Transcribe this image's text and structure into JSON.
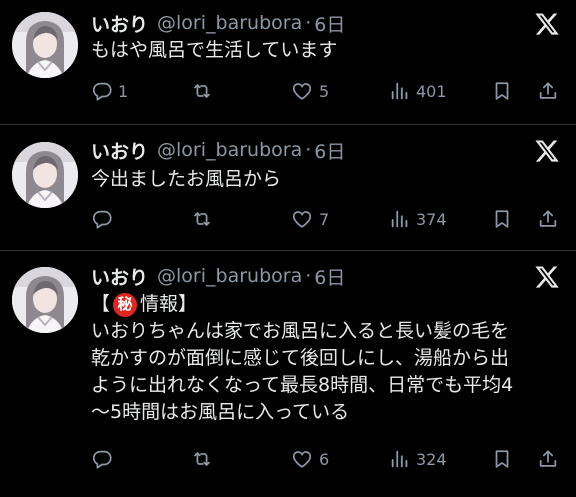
{
  "tweets": [
    {
      "display_name": "いおり",
      "handle": "@lori_barubora",
      "separator": "·",
      "time": "6日",
      "lines": [
        "もはや風呂で生活しています"
      ],
      "replies": "1",
      "retweets": "",
      "likes": "5",
      "views": "401"
    },
    {
      "display_name": "いおり",
      "handle": "@lori_barubora",
      "separator": "·",
      "time": "6日",
      "lines": [
        "今出ましたお風呂から"
      ],
      "replies": "",
      "retweets": "",
      "likes": "7",
      "views": "374"
    },
    {
      "display_name": "いおり",
      "handle": "@lori_barubora",
      "separator": "·",
      "time": "6日",
      "tag_open": "【",
      "tag_badge": "秘",
      "tag_label": "情報】",
      "lines": [
        "いおりちゃんは家でお風呂に入ると長い髪の毛を",
        "乾かすのが面倒に感じて後回しにし、湯船から出",
        "ように出れなくなって最長8時間、日常でも平均4",
        "〜5時間はお風呂に入っている"
      ],
      "replies": "",
      "retweets": "",
      "likes": "6",
      "views": "324"
    }
  ],
  "icons": {
    "platform_logo": "x-logo-icon",
    "reply": "reply-icon",
    "retweet": "retweet-icon",
    "like": "heart-icon",
    "views": "views-icon",
    "bookmark": "bookmark-icon",
    "share": "share-icon"
  },
  "colors": {
    "background": "#000000",
    "text_primary": "#e7e9ea",
    "text_secondary": "#8b98a5",
    "divider": "#2f3336",
    "secret_badge": "#e2261f"
  }
}
